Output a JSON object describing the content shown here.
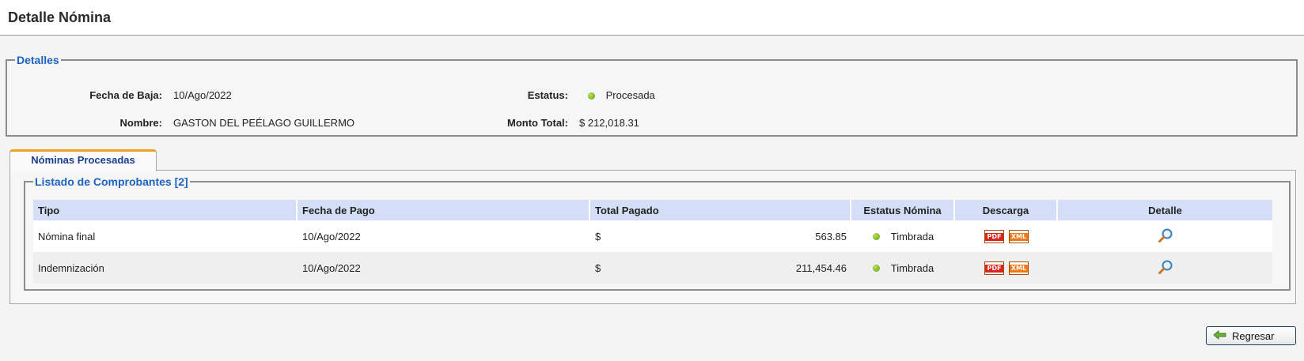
{
  "page": {
    "title": "Detalle Nómina"
  },
  "details": {
    "legend": "Detalles",
    "fecha_baja_label": "Fecha de Baja:",
    "fecha_baja_value": "10/Ago/2022",
    "nombre_label": "Nombre:",
    "nombre_value": "GASTON DEL PEÉLAGO GUILLERMO",
    "estatus_label": "Estatus:",
    "estatus_value": "Procesada",
    "monto_label": "Monto Total:",
    "monto_value": "$ 212,018.31"
  },
  "tab": {
    "label": "Nóminas Procesadas"
  },
  "listado": {
    "legend": "Listado de Comprobantes [2]",
    "headers": {
      "tipo": "Tipo",
      "fecha_pago": "Fecha de Pago",
      "total_pagado": "Total Pagado",
      "estatus_nomina": "Estatus Nómina",
      "descarga": "Descarga",
      "detalle": "Detalle"
    },
    "rows": [
      {
        "tipo": "Nómina final",
        "fecha_pago": "10/Ago/2022",
        "currency": "$",
        "total": "563.85",
        "estatus": "Timbrada"
      },
      {
        "tipo": "Indemnización",
        "fecha_pago": "10/Ago/2022",
        "currency": "$",
        "total": "211,454.46",
        "estatus": "Timbrada"
      }
    ],
    "icons": {
      "pdf": "PDF",
      "xml": "XML"
    }
  },
  "buttons": {
    "regresar": "Regresar"
  },
  "colors": {
    "accent": "#1b62c4",
    "status_ok": "#6aa61a",
    "tab_top": "#f0a020",
    "header_row": "#d4dff7"
  }
}
